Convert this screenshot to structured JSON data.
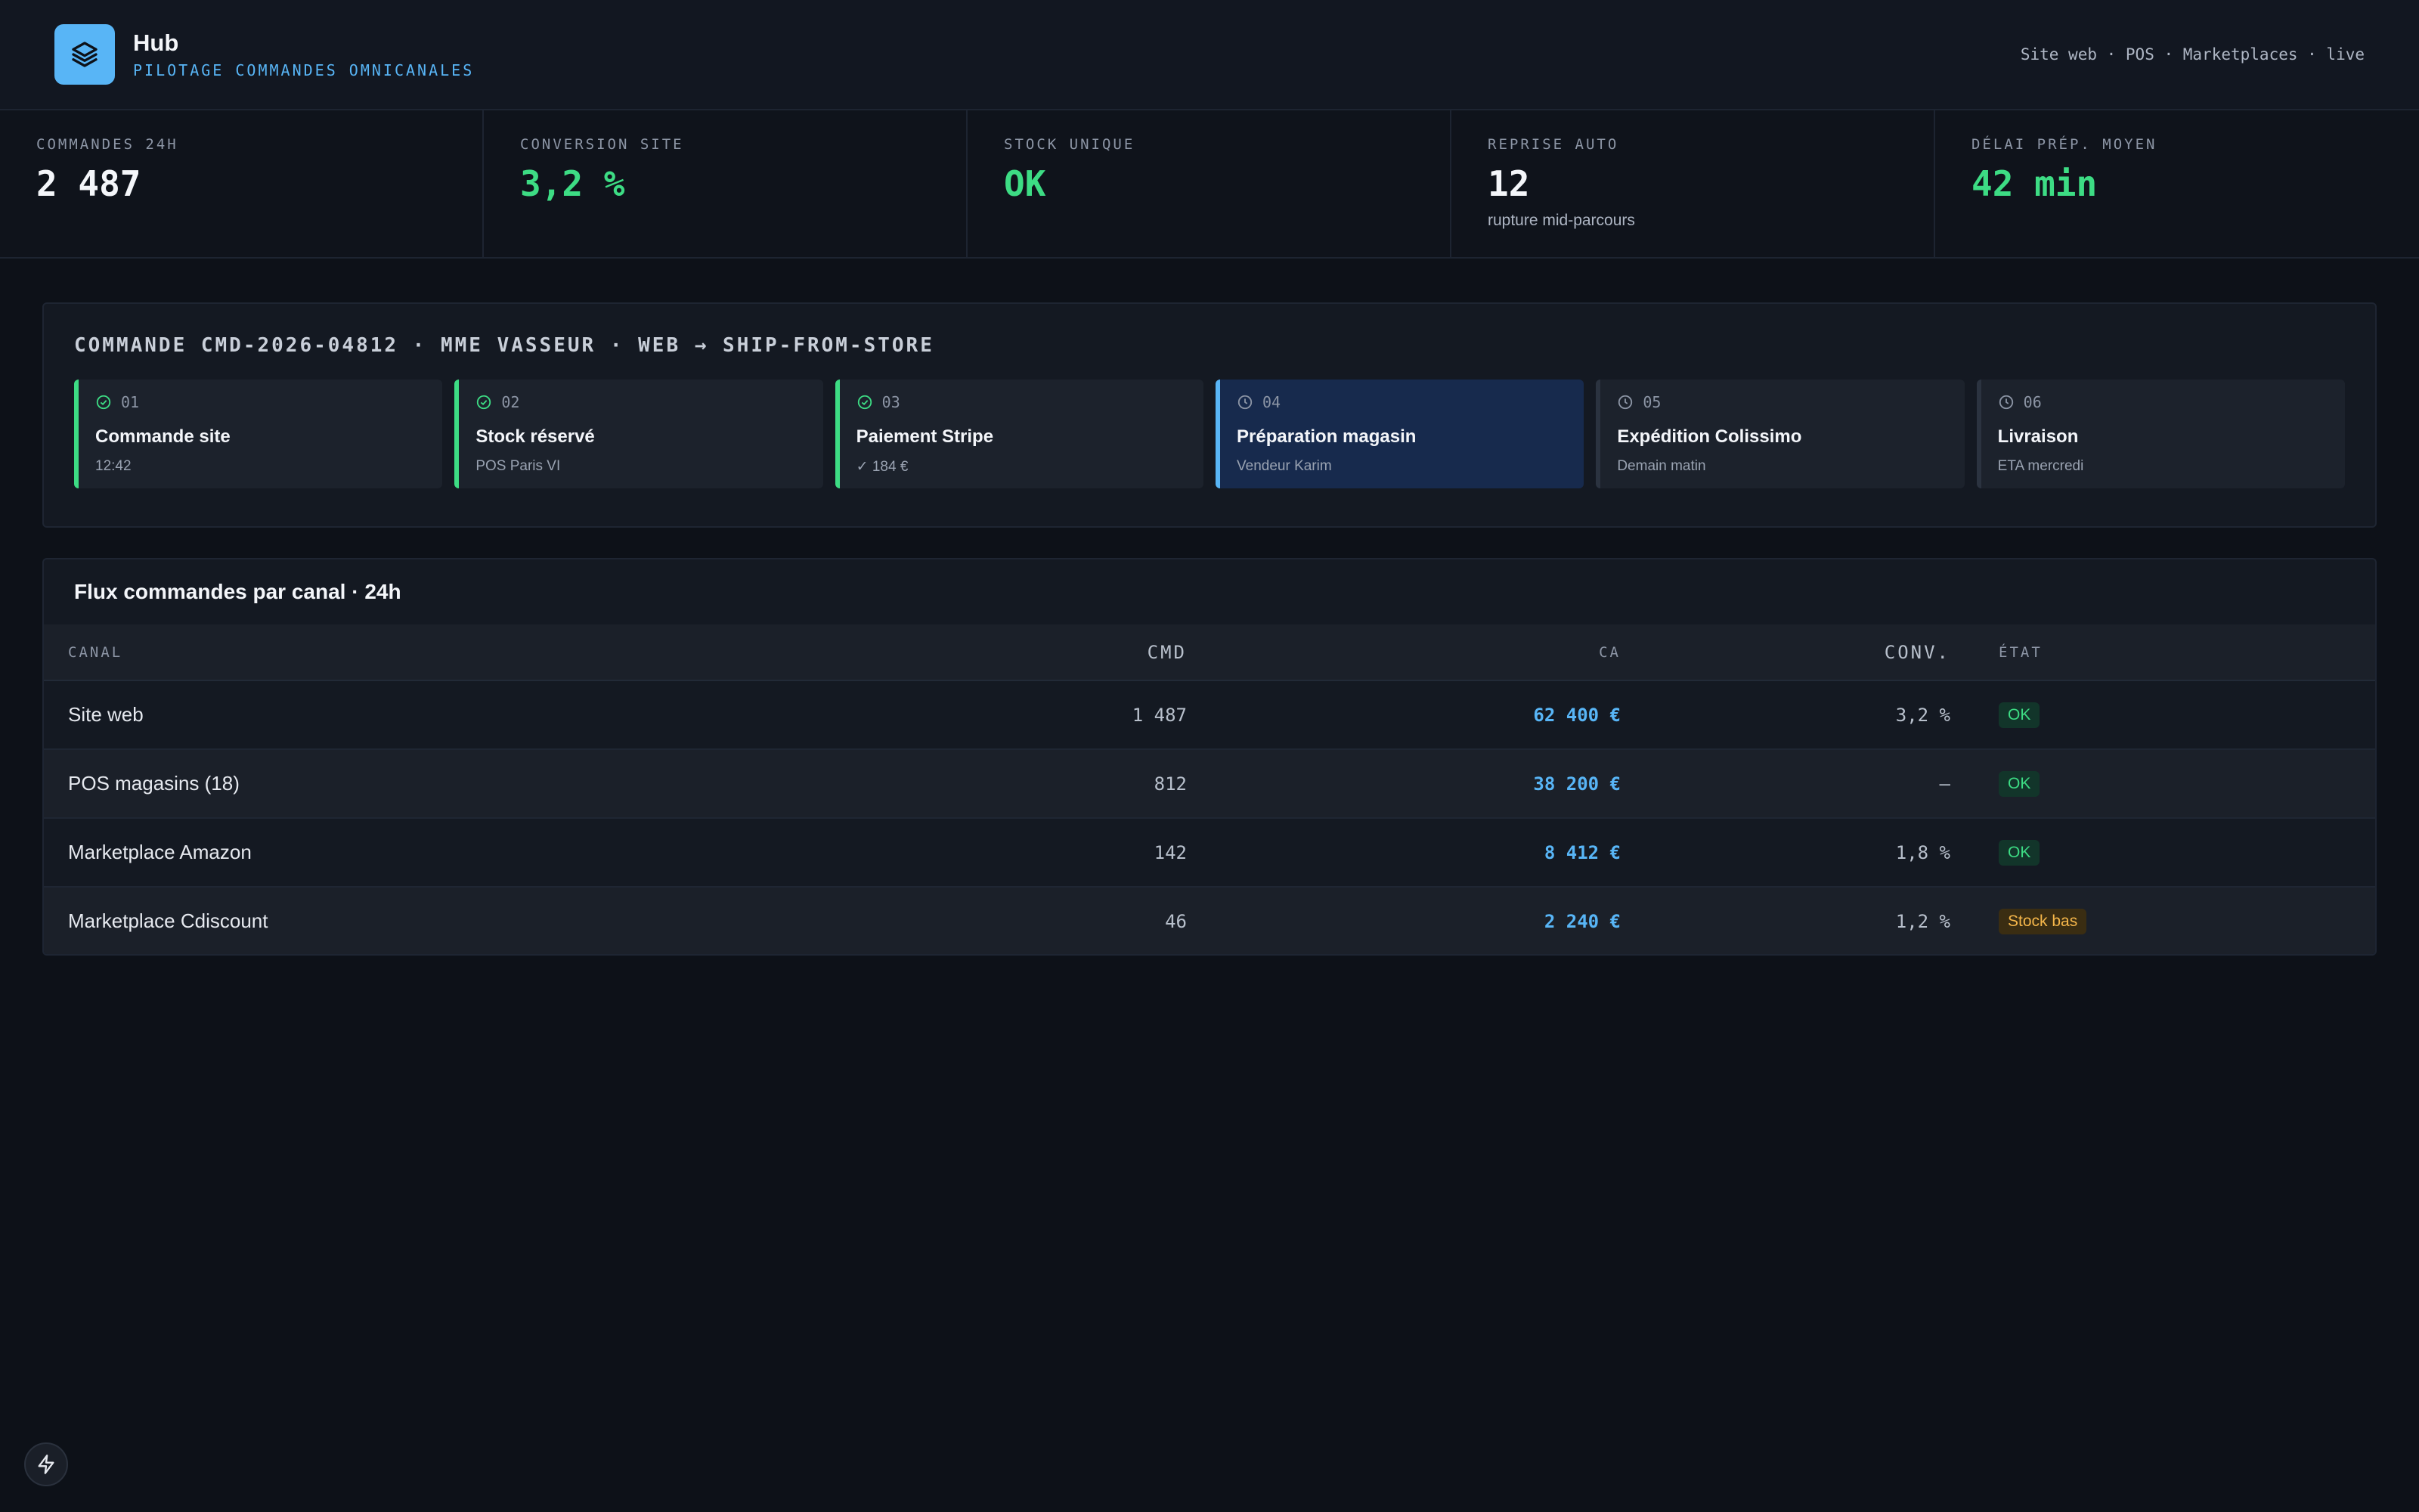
{
  "app": {
    "title": "Hub",
    "subtitle": "PILOTAGE COMMANDES OMNICANALES",
    "channels_status": "Site web · POS · Marketplaces · live",
    "logo_icon": "layers-icon"
  },
  "kpis": [
    {
      "label": "COMMANDES 24H",
      "value": "2 487",
      "note": "",
      "color": "#f4f6fa"
    },
    {
      "label": "CONVERSION SITE",
      "value": "3,2 %",
      "note": "",
      "color": "#3ddc84"
    },
    {
      "label": "STOCK UNIQUE",
      "value": "OK",
      "note": "",
      "color": "#3ddc84"
    },
    {
      "label": "REPRISE AUTO",
      "value": "12",
      "note": "rupture mid-parcours",
      "color": "#f4f6fa"
    },
    {
      "label": "DÉLAI PRÉP. MOYEN",
      "value": "42 min",
      "note": "",
      "color": "#3ddc84"
    }
  ],
  "order": {
    "title": "COMMANDE CMD-2026-04812 · MME VASSEUR · WEB → SHIP-FROM-STORE",
    "steps": [
      {
        "num": "01",
        "name": "Commande site",
        "meta": "12:42",
        "status": "done"
      },
      {
        "num": "02",
        "name": "Stock réservé",
        "meta": "POS Paris VI",
        "status": "done"
      },
      {
        "num": "03",
        "name": "Paiement Stripe",
        "meta": "✓ 184 €",
        "status": "done"
      },
      {
        "num": "04",
        "name": "Préparation magasin",
        "meta": "Vendeur Karim",
        "status": "active"
      },
      {
        "num": "05",
        "name": "Expédition Colissimo",
        "meta": "Demain matin",
        "status": "pending"
      },
      {
        "num": "06",
        "name": "Livraison",
        "meta": "ETA mercredi",
        "status": "pending"
      }
    ]
  },
  "flux": {
    "title": "Flux commandes par canal · 24h",
    "headers": {
      "canal": "CANAL",
      "cmd": "CMD",
      "ca": "CA",
      "conv": "CONV.",
      "etat": "ÉTAT"
    },
    "rows": [
      {
        "canal": "Site web",
        "cmd": "1 487",
        "ca": "62 400 €",
        "conv": "3,2 %",
        "etat": "OK",
        "etat_type": "ok"
      },
      {
        "canal": "POS magasins (18)",
        "cmd": "812",
        "ca": "38 200 €",
        "conv": "—",
        "etat": "OK",
        "etat_type": "ok"
      },
      {
        "canal": "Marketplace Amazon",
        "cmd": "142",
        "ca": "8 412 €",
        "conv": "1,8 %",
        "etat": "OK",
        "etat_type": "ok"
      },
      {
        "canal": "Marketplace Cdiscount",
        "cmd": "46",
        "ca": "2 240 €",
        "conv": "1,2 %",
        "etat": "Stock bas",
        "etat_type": "warn"
      }
    ]
  },
  "colors": {
    "accent": "#58b5f6",
    "success": "#3ddc84",
    "warning": "#f5b64a",
    "background": "#0d1118"
  },
  "fab_icon": "bolt-icon"
}
